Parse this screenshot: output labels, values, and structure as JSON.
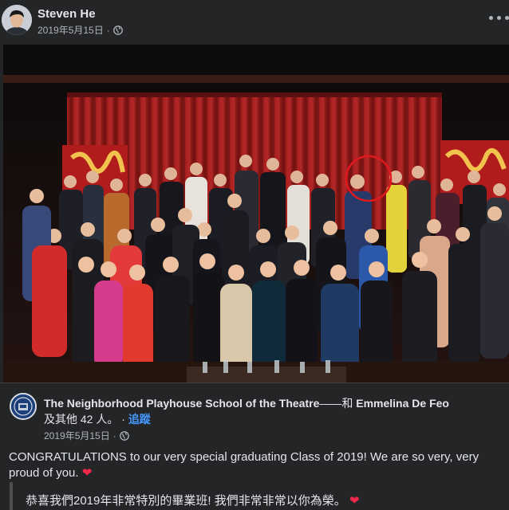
{
  "post": {
    "author": "Steven He",
    "date": "2019年5月15日",
    "separator": "·",
    "privacy_icon": "globe-icon"
  },
  "shared": {
    "page_name": "The Neighborhood Playhouse School of the Theatre",
    "with_text": "——和",
    "tagged_name": "Emmelina De Feo",
    "others_text": "及其他 42 人",
    "others_sep": "。 ·",
    "follow_label": "追蹤",
    "date": "2019年5月15日",
    "separator": "·",
    "message": "CONGRATULATIONS to our very special graduating Class of 2019! We are so very, very proud of you.",
    "heart": "❤",
    "translation": "恭喜我們2019年非常特別的畢業班! 我們非常非常以你為榮。"
  },
  "colors": {
    "background": "#242526",
    "text": "#e4e6eb",
    "secondary_text": "#b0b3b8",
    "link": "#4599ff",
    "heart": "#f02849",
    "highlight_circle": "#e0191e",
    "curtain": "#a31d1d"
  }
}
